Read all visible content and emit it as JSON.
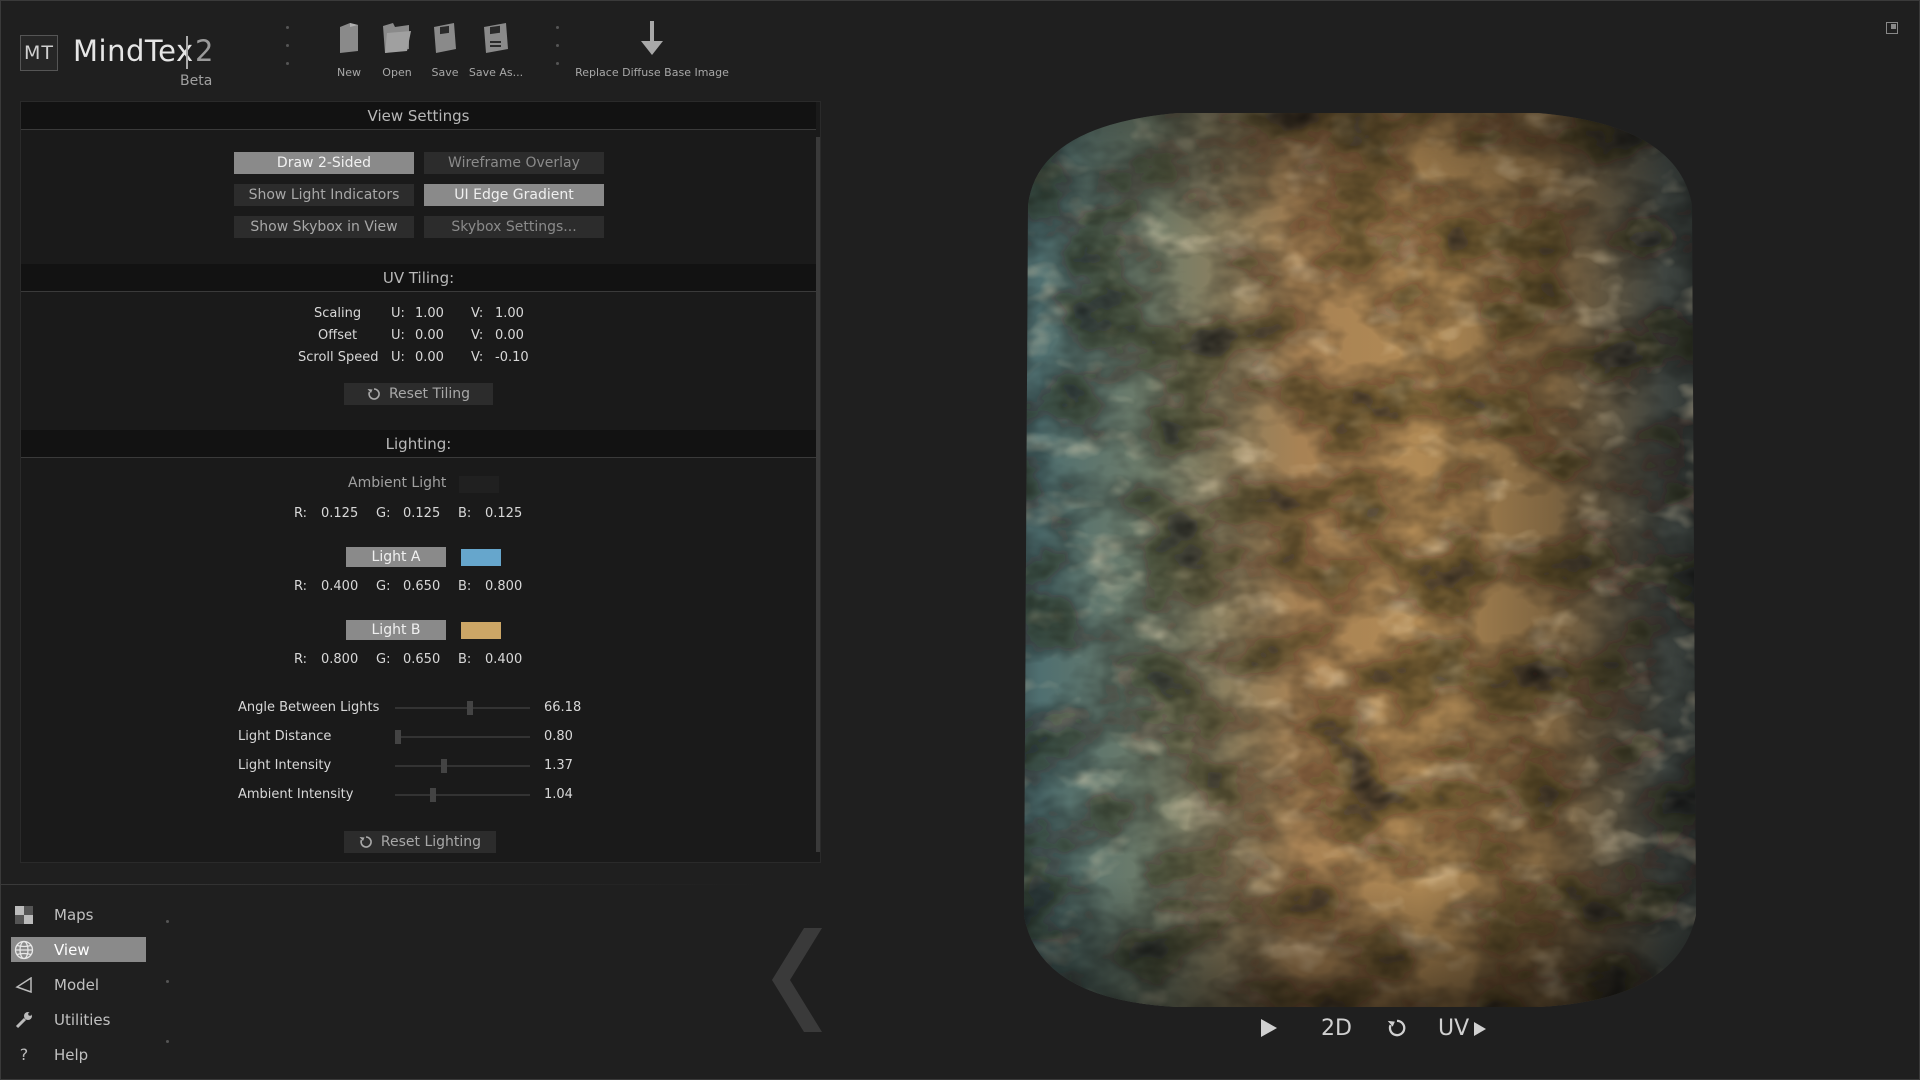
{
  "app": {
    "logo": "MT",
    "title": "MindTex",
    "version": "2",
    "stage": "Beta"
  },
  "toolbar": {
    "new_label": "New",
    "open_label": "Open",
    "save_label": "Save",
    "save_as_label": "Save As...",
    "replace_label": "Replace Diffuse Base Image"
  },
  "view_settings": {
    "header": "View Settings",
    "buttons": [
      {
        "label": "Draw 2-Sided",
        "active": true
      },
      {
        "label": "Wireframe Overlay",
        "active": false
      },
      {
        "label": "Show Light Indicators",
        "active": false
      },
      {
        "label": "UI Edge Gradient",
        "active": true
      },
      {
        "label": "Show Skybox in View",
        "active": false
      },
      {
        "label": "Skybox Settings...",
        "active": false
      }
    ]
  },
  "uv_tiling": {
    "header": "UV Tiling:",
    "u_label": "U:",
    "v_label": "V:",
    "rows": [
      {
        "label": "Scaling",
        "u": "1.00",
        "v": "1.00"
      },
      {
        "label": "Offset",
        "u": "0.00",
        "v": "0.00"
      },
      {
        "label": "Scroll Speed",
        "u": "0.00",
        "v": "-0.10"
      }
    ],
    "reset_label": "Reset Tiling"
  },
  "lighting": {
    "header": "Lighting:",
    "r_label": "R:",
    "g_label": "G:",
    "b_label": "B:",
    "ambient": {
      "label": "Ambient Light",
      "r": "0.125",
      "g": "0.125",
      "b": "0.125",
      "color": "#202020"
    },
    "light_a": {
      "label": "Light A",
      "r": "0.400",
      "g": "0.650",
      "b": "0.800",
      "color": "#66a6cc"
    },
    "light_b": {
      "label": "Light B",
      "r": "0.800",
      "g": "0.650",
      "b": "0.400",
      "color": "#cca666"
    },
    "sliders": [
      {
        "label": "Angle Between Lights",
        "value": "66.18",
        "fraction": 0.56
      },
      {
        "label": "Light Distance",
        "value": "0.80",
        "fraction": 0.0
      },
      {
        "label": "Light Intensity",
        "value": "1.37",
        "fraction": 0.36
      },
      {
        "label": "Ambient Intensity",
        "value": "1.04",
        "fraction": 0.27
      }
    ],
    "reset_label": "Reset Lighting"
  },
  "nav": {
    "items": [
      {
        "label": "Maps",
        "icon": "checker-icon",
        "active": false
      },
      {
        "label": "View",
        "icon": "globe-icon",
        "active": true
      },
      {
        "label": "Model",
        "icon": "triangle-icon",
        "active": false
      },
      {
        "label": "Utilities",
        "icon": "wrench-icon",
        "active": false
      },
      {
        "label": "Help",
        "icon": "question-icon",
        "active": false
      }
    ]
  },
  "viewport": {
    "mode_2d": "2D",
    "uv_label": "UV"
  },
  "colors": {
    "background": "#1f1f1f",
    "panel": "#1a1a1a",
    "active_button": "#8a8a8a",
    "material_gold": "#a87e44",
    "material_teal": "#5f8a8c"
  }
}
